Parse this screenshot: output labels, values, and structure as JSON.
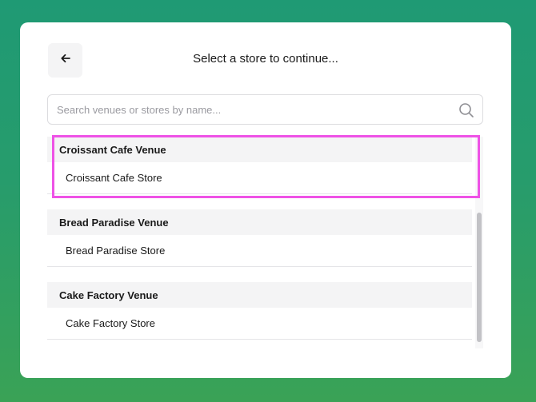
{
  "header": {
    "title": "Select a store to continue...",
    "back_icon": "arrow-left-icon"
  },
  "search": {
    "placeholder": "Search venues or stores by name...",
    "value": "",
    "icon": "search-icon"
  },
  "venues": [
    {
      "name": "Croissant Cafe Venue",
      "stores": [
        "Croissant Cafe Store"
      ]
    },
    {
      "name": "Bread Paradise Venue",
      "stores": [
        "Bread Paradise Store"
      ]
    },
    {
      "name": "Cake Factory Venue",
      "stores": [
        "Cake Factory Store"
      ]
    }
  ],
  "colors": {
    "background_start": "#1f9a74",
    "background_end": "#3aa256",
    "highlight": "#ee52e6",
    "venue_header_bg": "#f4f4f5"
  }
}
